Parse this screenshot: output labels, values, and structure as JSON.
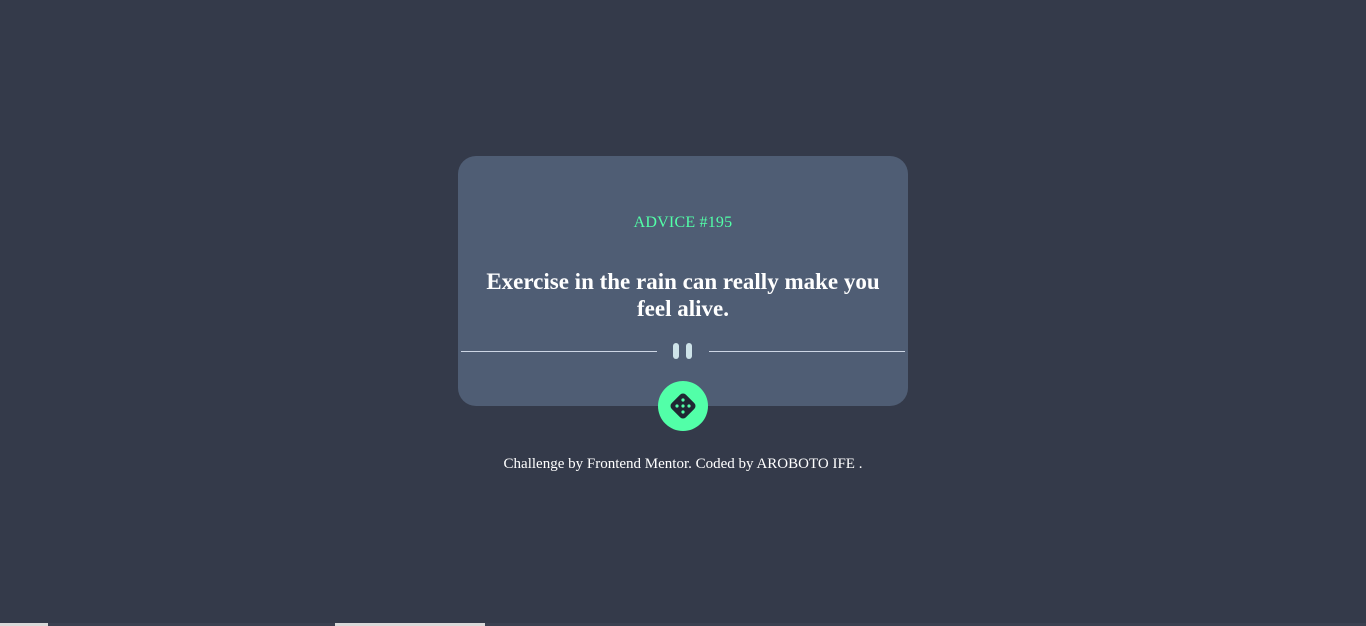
{
  "card": {
    "advice_label": "ADVICE #195",
    "advice_text": "Exercise in the rain can really make you feel alive."
  },
  "dice_button": {
    "icon": "dice-icon",
    "color": "#52ffa8"
  },
  "divider": {
    "icon": "pause-icon"
  },
  "footer": {
    "prefix": "Challenge by ",
    "challenge_link": "Frontend Mentor",
    "middle": ". Coded by ",
    "author_link": "AROBOTO IFE",
    "suffix": " ."
  },
  "colors": {
    "background": "#343a4a",
    "card": "#4f5d74",
    "accent": "#52ffa8",
    "text": "#ffffff"
  }
}
